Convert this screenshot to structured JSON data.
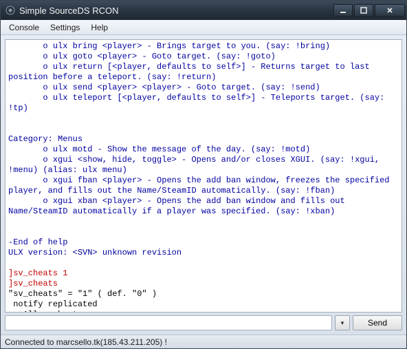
{
  "window": {
    "title": "Simple SourceDS RCON"
  },
  "menu": {
    "console": "Console",
    "settings": "Settings",
    "help": "Help"
  },
  "console": {
    "lines": [
      {
        "cls": "blue",
        "text": "       o ulx bring <player> - Brings target to you. (say: !bring)"
      },
      {
        "cls": "blue",
        "text": "       o ulx goto <player> - Goto target. (say: !goto)"
      },
      {
        "cls": "blue",
        "text": "       o ulx return [<player, defaults to self>] - Returns target to last position before a teleport. (say: !return)"
      },
      {
        "cls": "blue",
        "text": "       o ulx send <player> <player> - Goto target. (say: !send)"
      },
      {
        "cls": "blue",
        "text": "       o ulx teleport [<player, defaults to self>] - Teleports target. (say: !tp)"
      },
      {
        "cls": "blue",
        "text": ""
      },
      {
        "cls": "blue",
        "text": ""
      },
      {
        "cls": "blue",
        "text": "Category: Menus"
      },
      {
        "cls": "blue",
        "text": "       o ulx motd - Show the message of the day. (say: !motd)"
      },
      {
        "cls": "blue",
        "text": "       o xgui <show, hide, toggle> - Opens and/or closes XGUI. (say: !xgui, !menu) (alias: ulx menu)"
      },
      {
        "cls": "blue",
        "text": "       o xgui fban <player> - Opens the add ban window, freezes the specified player, and fills out the Name/SteamID automatically. (say: !fban)"
      },
      {
        "cls": "blue",
        "text": "       o xgui xban <player> - Opens the add ban window and fills out Name/SteamID automatically if a player was specified. (say: !xban)"
      },
      {
        "cls": "blue",
        "text": ""
      },
      {
        "cls": "blue",
        "text": ""
      },
      {
        "cls": "blue",
        "text": "-End of help"
      },
      {
        "cls": "blue",
        "text": "ULX version: <SVN> unknown revision"
      },
      {
        "cls": "blue",
        "text": ""
      },
      {
        "cls": "red",
        "text": "]sv_cheats 1"
      },
      {
        "cls": "red",
        "text": "]sv_cheats"
      },
      {
        "cls": "black",
        "text": "\"sv_cheats\" = \"1\" ( def. \"0\" )"
      },
      {
        "cls": "black",
        "text": " notify replicated"
      },
      {
        "cls": "black",
        "text": " - Allow cheats on server"
      },
      {
        "cls": "black",
        "text": ""
      }
    ]
  },
  "input": {
    "value": "",
    "send_label": "Send",
    "history_glyph": "▼"
  },
  "status": {
    "text": "Connected to marcsello.tk(185.43.211.205) !"
  }
}
